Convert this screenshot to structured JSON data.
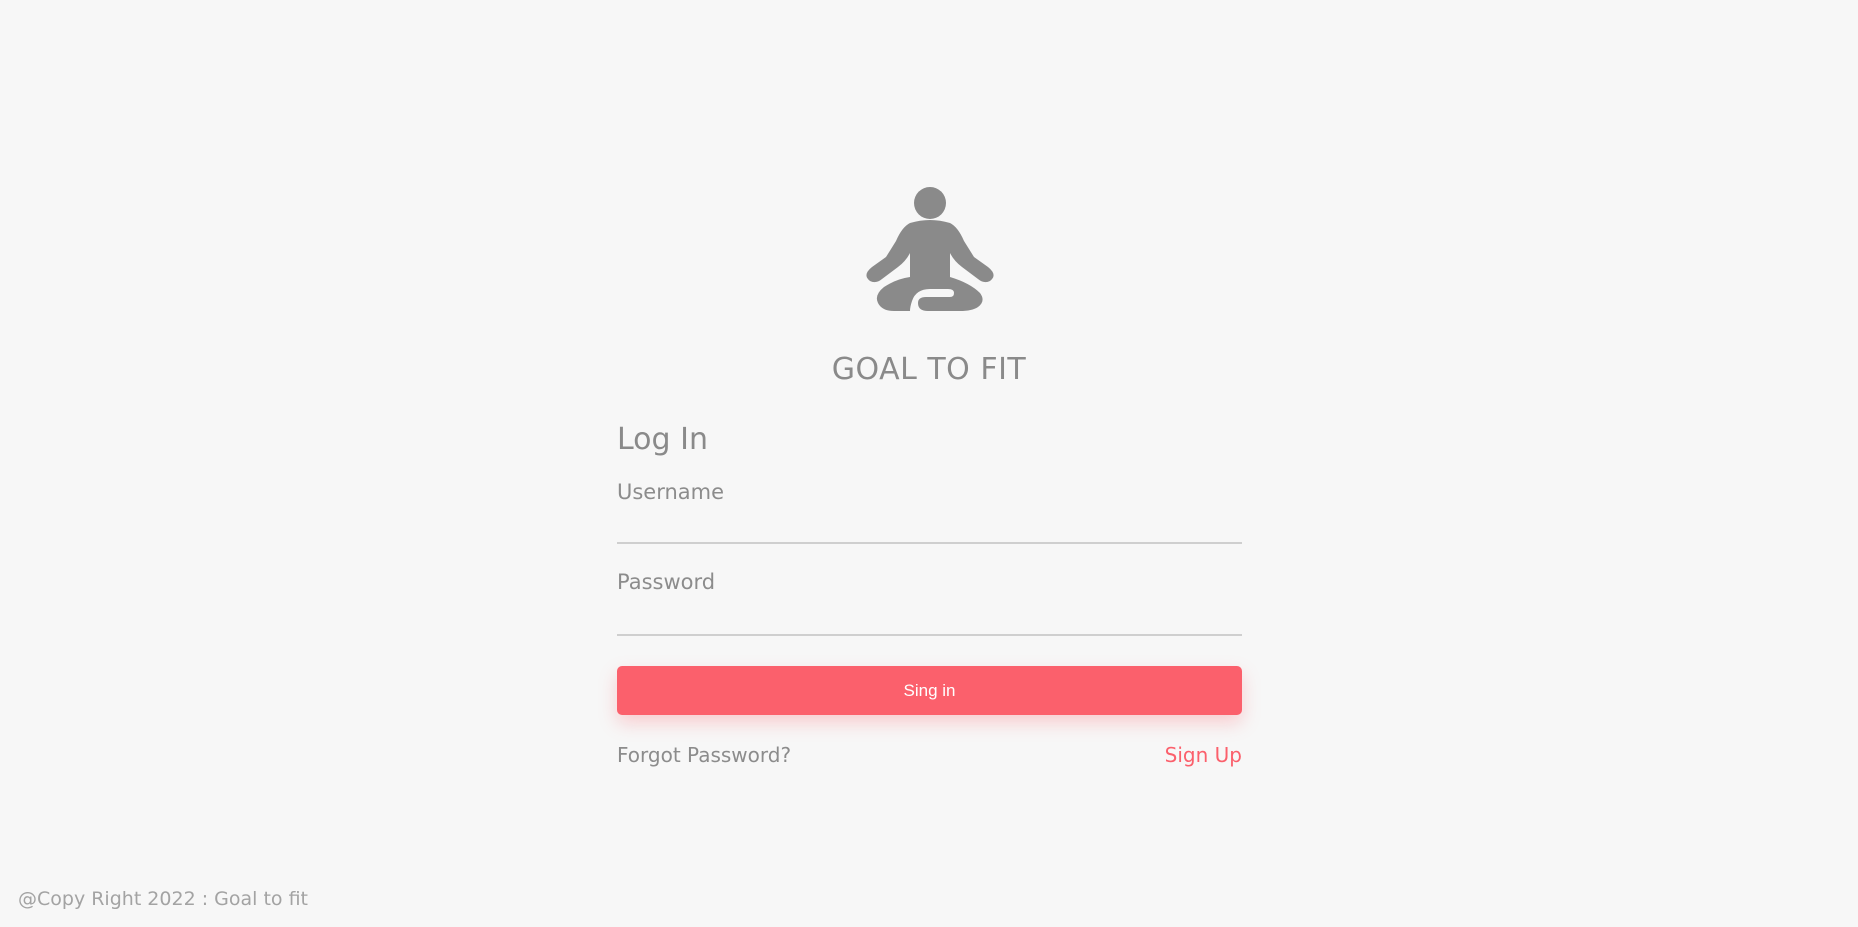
{
  "brand": {
    "title": "GOAL TO FIT",
    "logo_icon": "meditation-pose-icon"
  },
  "login": {
    "heading": "Log In",
    "username_label": "Username",
    "username_value": "",
    "password_label": "Password",
    "password_value": "",
    "submit_label": "Sing in",
    "forgot_label": "Forgot Password?",
    "signup_label": "Sign Up"
  },
  "footer": {
    "copyright": "@Copy Right 2022 : Goal to fit"
  },
  "colors": {
    "background": "#f7f7f7",
    "accent": "#fb606c",
    "text_muted": "#8a8a8a"
  }
}
